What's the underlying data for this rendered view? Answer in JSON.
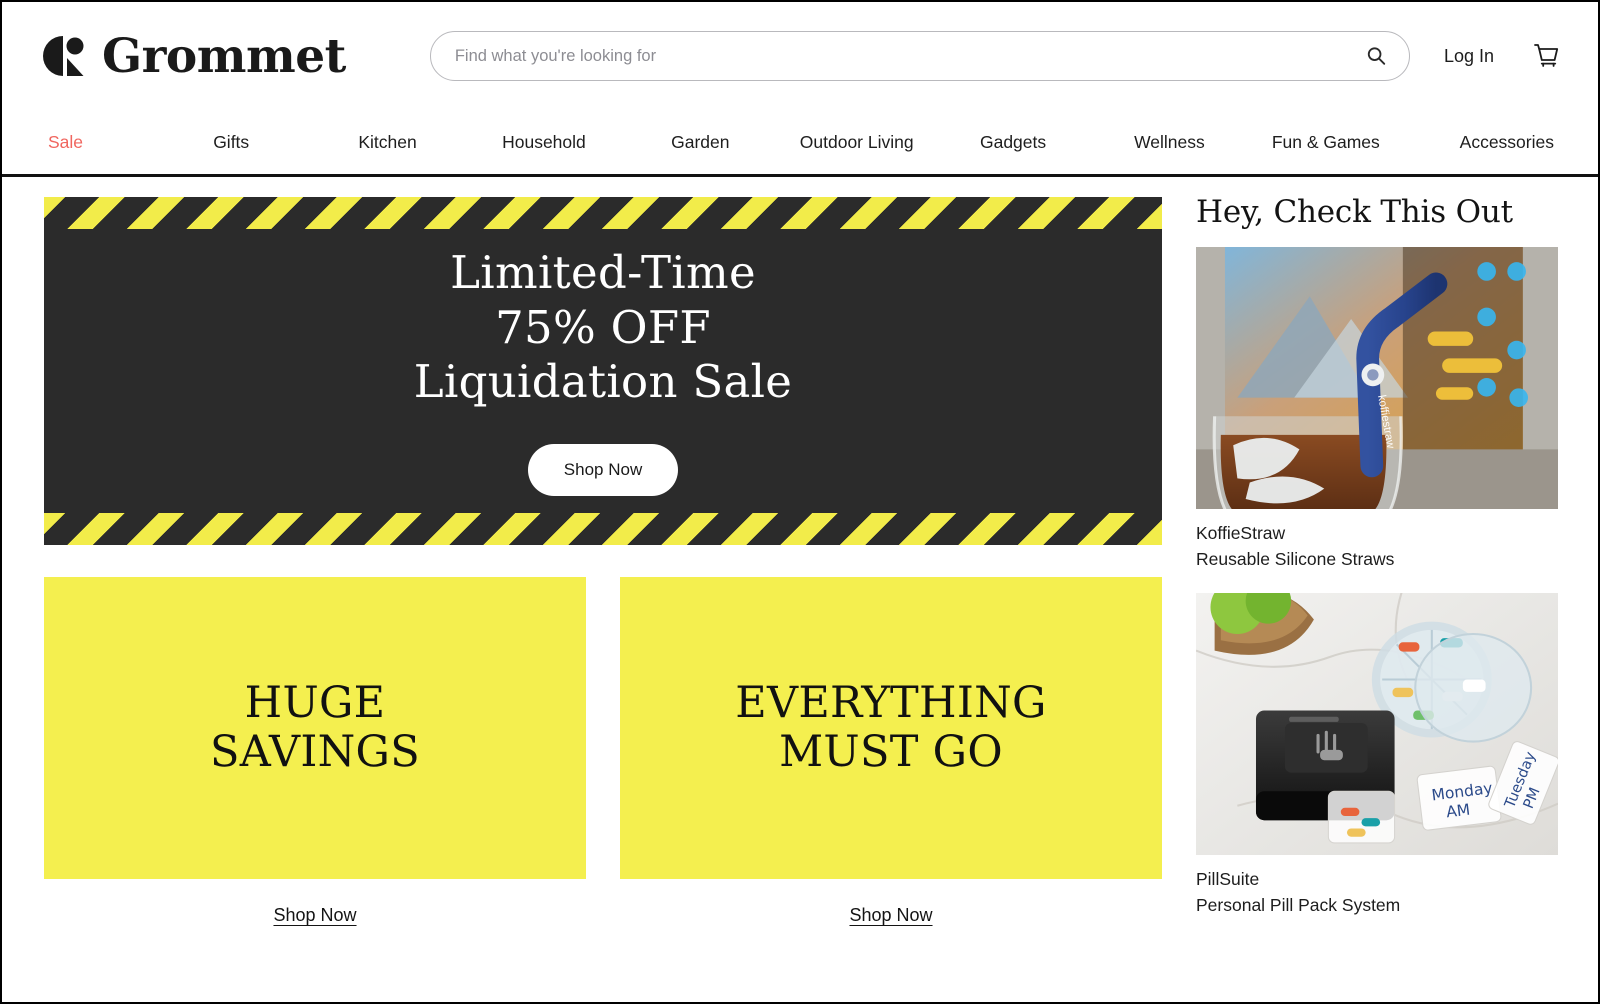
{
  "brand": {
    "name": "Grommet",
    "logo_icon": "grommet-logo-mark"
  },
  "search": {
    "placeholder": "Find what you're looking for",
    "value": "",
    "icon": "search-icon"
  },
  "header": {
    "login_label": "Log In",
    "cart_icon": "shopping-cart-icon"
  },
  "nav": {
    "items": [
      {
        "label": "Sale",
        "accent": true
      },
      {
        "label": "Gifts",
        "accent": false
      },
      {
        "label": "Kitchen",
        "accent": false
      },
      {
        "label": "Household",
        "accent": false
      },
      {
        "label": "Garden",
        "accent": false
      },
      {
        "label": "Outdoor Living",
        "accent": false
      },
      {
        "label": "Gadgets",
        "accent": false
      },
      {
        "label": "Wellness",
        "accent": false
      },
      {
        "label": "Fun & Games",
        "accent": false
      },
      {
        "label": "Accessories",
        "accent": false
      }
    ]
  },
  "hero": {
    "line1": "Limited-Time",
    "line2": "75% OFF",
    "line3": "Liquidation Sale",
    "cta_label": "Shop Now"
  },
  "promos": [
    {
      "line1": "Huge",
      "line2": "Savings",
      "link_label": "Shop Now"
    },
    {
      "line1": "Everything",
      "line2": "Must Go",
      "link_label": "Shop Now"
    }
  ],
  "sidebar": {
    "title": "Hey, Check This Out",
    "cards": [
      {
        "name": "KoffieStraw",
        "description": "Reusable Silicone Straws",
        "image_alt": "blue-silicone-straw-in-iced-drink"
      },
      {
        "name": "PillSuite",
        "description": "Personal Pill Pack System",
        "image_alt": "pill-dispenser-and-labeled-pill-packs"
      }
    ]
  },
  "colors": {
    "accent_sale": "#f0665f",
    "promo_yellow": "#f4ef4f",
    "hero_dark": "#2b2b2b",
    "hazard_yellow": "#f2ec4a"
  }
}
